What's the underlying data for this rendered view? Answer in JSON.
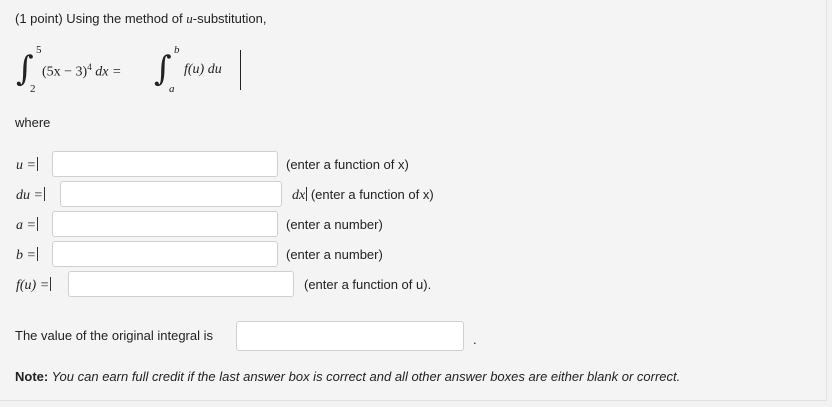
{
  "header": {
    "prefix": "(1 point) Using the method of ",
    "variable": "u",
    "suffix": "-substitution,"
  },
  "integral": {
    "left_lower": "2",
    "left_upper": "5",
    "left_integrand": "(5x − 3)",
    "left_exponent": "4",
    "left_dx": " dx =",
    "right_lower": "a",
    "right_upper": "b",
    "right_integrand": "f(u) du"
  },
  "where_label": "where",
  "rows": [
    {
      "label": "u =",
      "hint": "(enter a function of x)",
      "value": ""
    },
    {
      "label": "du =",
      "suffix": "dx",
      "hint": "(enter a function of x)",
      "value": ""
    },
    {
      "label": "a =",
      "hint": "(enter a number)",
      "value": ""
    },
    {
      "label": "b =",
      "hint": "(enter a number)",
      "value": ""
    },
    {
      "label": "f(u) =",
      "hint": "(enter a function of u).",
      "value": ""
    }
  ],
  "final": {
    "label": "The value of the original integral is",
    "value": "",
    "period": "."
  },
  "note": {
    "bold": "Note:",
    "text": " You can earn full credit if the last answer box is correct and all other answer boxes are either blank or correct."
  }
}
